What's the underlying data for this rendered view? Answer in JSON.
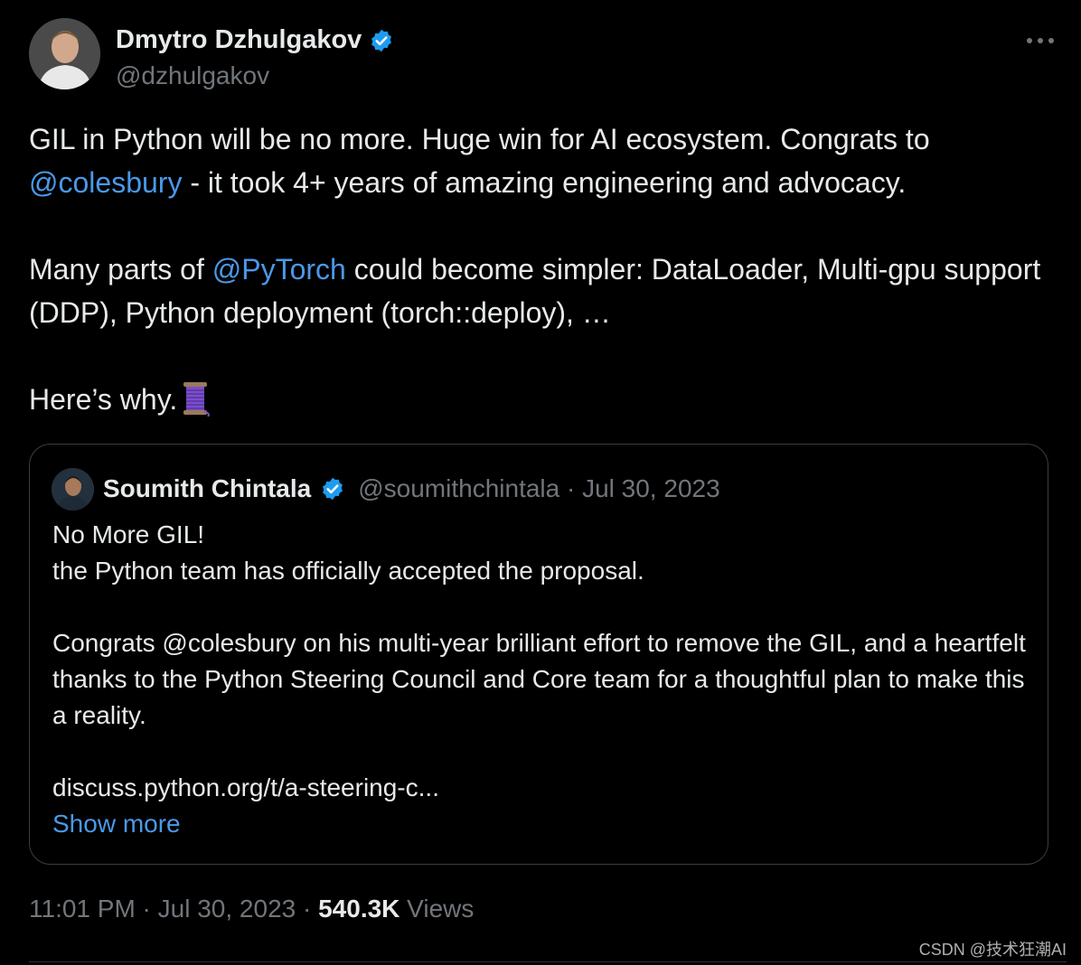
{
  "author": {
    "name": "Dmytro Dzhulgakov",
    "handle": "@dzhulgakov"
  },
  "more_icon": "more-horizontal-icon",
  "tweet": {
    "line1_prefix": "GIL in Python will be no more. Huge win for AI ecosystem. Congrats to",
    "mention1": "@colesbury",
    "line1_suffix": " - it took 4+ years of amazing engineering and advocacy.",
    "para2_prefix": "Many parts of ",
    "mention2": "@PyTorch",
    "para2_suffix": " could become simpler: DataLoader, Multi-gpu support (DDP), Python deployment (torch::deploy), …",
    "para3": "Here’s why.",
    "emoji": "thread-spool-emoji"
  },
  "quote": {
    "name": "Soumith Chintala",
    "handle_date": "@soumithchintala · Jul 30, 2023",
    "line1": "No More GIL!",
    "line2": "the Python team has officially accepted the proposal.",
    "para2": "Congrats @colesbury on his multi-year brilliant effort to remove the GIL, and a heartfelt thanks to the Python Steering Council and Core team for a thoughtful plan to make this a reality.",
    "link": "discuss.python.org/t/a-steering-c...",
    "show_more": "Show more"
  },
  "meta": {
    "timestamp": "11:01 PM · Jul 30, 2023 · ",
    "views_count": "540.3K",
    "views_label": " Views"
  },
  "watermark": "CSDN @技术狂潮AI",
  "colors": {
    "background": "#000000",
    "text": "#e7e9ea",
    "secondary": "#71767b",
    "link": "#4a99e9",
    "verified": "#1d9bf0"
  }
}
